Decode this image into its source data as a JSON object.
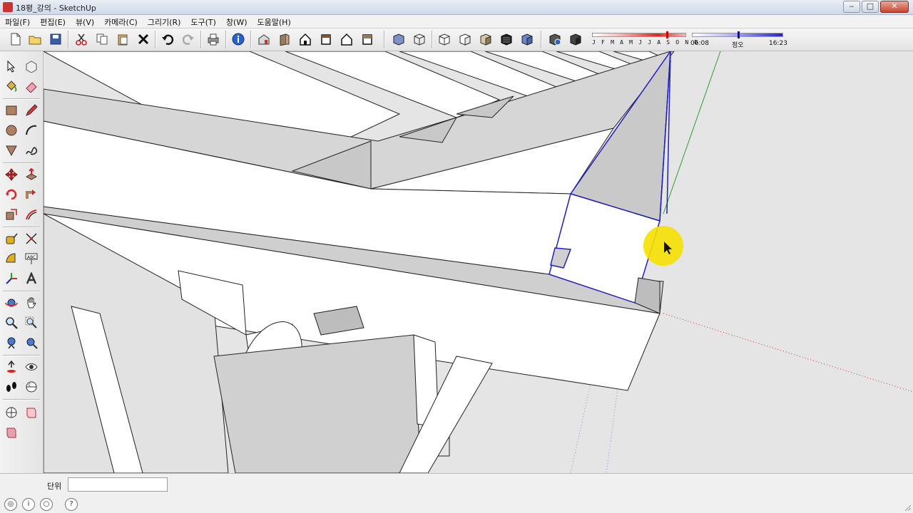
{
  "window": {
    "title": "18평_강의 - SketchUp"
  },
  "menu": [
    "파일(F)",
    "편집(E)",
    "뷰(V)",
    "카메라(C)",
    "그리기(R)",
    "도구(T)",
    "창(W)",
    "도움말(H)"
  ],
  "toolbar": {
    "buttons": [
      "new-file-icon",
      "open-folder-icon",
      "save-icon",
      "cut-icon",
      "copy-icon",
      "paste-icon",
      "erase-icon",
      "undo-icon",
      "redo-icon",
      "print-icon",
      "model-info-icon",
      "iso-view-icon",
      "top-view-icon",
      "front-view-icon",
      "right-view-icon",
      "back-view-icon",
      "left-view-icon",
      "xray-icon",
      "wireframe-icon",
      "hidden-line-icon",
      "shaded-icon",
      "shaded-textures-icon",
      "monochrome-icon",
      "component-icon",
      "section-plane-icon"
    ]
  },
  "shadow": {
    "months": "J F M A M J J A S O N D",
    "time_start": "06:08",
    "time_mid": "정오",
    "time_end": "16:23",
    "accent": "#e02020",
    "accent2": "#2020c0"
  },
  "statusbar": {
    "vcb_label": "단위",
    "vcb_value": ""
  }
}
